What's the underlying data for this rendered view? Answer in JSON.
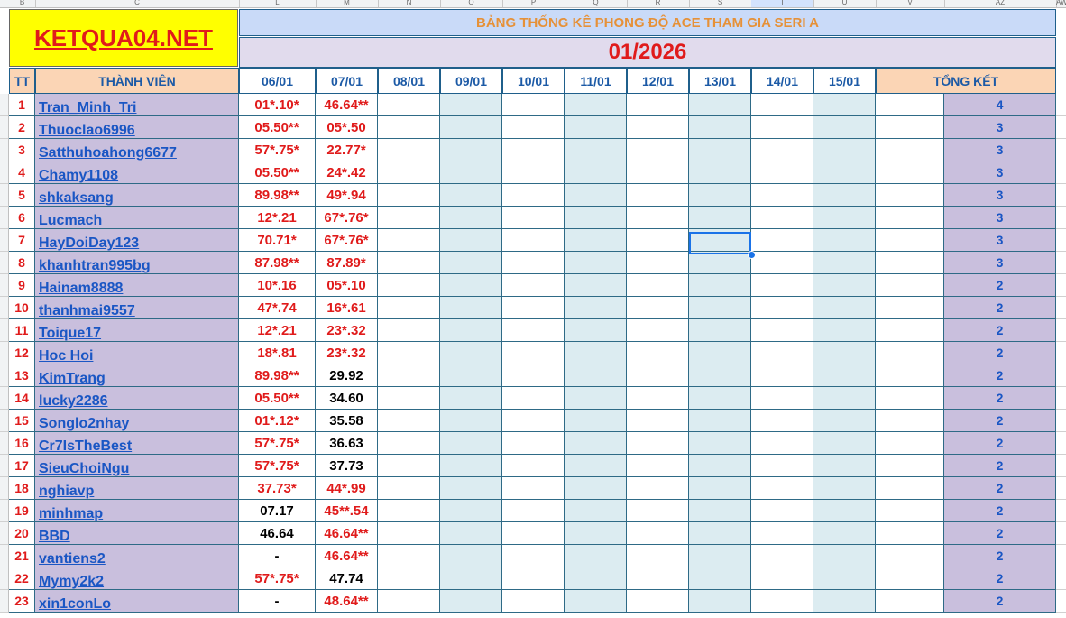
{
  "column_header_strip": {
    "letters": [
      "B",
      "C",
      "L",
      "M",
      "N",
      "O",
      "P",
      "Q",
      "R",
      "S",
      "T",
      "U",
      "V",
      "AZ",
      "AW"
    ]
  },
  "sheet": {
    "logo_text": "KETQUA04.NET",
    "title": "BẢNG THỐNG KÊ PHONG ĐỘ ACE THAM GIA SERI A",
    "month": "01/2026",
    "headers": {
      "tt": "TT",
      "member": "THÀNH VIÊN",
      "dates": [
        "06/01",
        "07/01",
        "08/01",
        "09/01",
        "10/01",
        "11/01",
        "12/01",
        "13/01",
        "14/01",
        "15/01"
      ],
      "summary": "TỔNG KẾT"
    },
    "rows": [
      {
        "tt": "1",
        "name": "Tran_Minh_Tri",
        "d1": "01*.10*",
        "d1c": "red",
        "d2": "46.64**",
        "d2c": "red",
        "total": "4"
      },
      {
        "tt": "2",
        "name": "Thuoclao6996",
        "d1": "05.50**",
        "d1c": "red",
        "d2": "05*.50",
        "d2c": "red",
        "total": "3"
      },
      {
        "tt": "3",
        "name": "Satthuhoahong6677",
        "d1": "57*.75*",
        "d1c": "red",
        "d2": "22.77*",
        "d2c": "red",
        "total": "3"
      },
      {
        "tt": "4",
        "name": "Chamy1108",
        "d1": "05.50**",
        "d1c": "red",
        "d2": "24*.42",
        "d2c": "red",
        "total": "3"
      },
      {
        "tt": "5",
        "name": "shkaksang",
        "d1": "89.98**",
        "d1c": "red",
        "d2": "49*.94",
        "d2c": "red",
        "total": "3"
      },
      {
        "tt": "6",
        "name": "Lucmach",
        "d1": "12*.21",
        "d1c": "red",
        "d2": "67*.76*",
        "d2c": "red",
        "total": "3"
      },
      {
        "tt": "7",
        "name": "HayDoiDay123",
        "d1": "70.71*",
        "d1c": "red",
        "d2": "67*.76*",
        "d2c": "red",
        "total": "3"
      },
      {
        "tt": "8",
        "name": "khanhtran995bg",
        "d1": "87.98**",
        "d1c": "red",
        "d2": "87.89*",
        "d2c": "red",
        "total": "3"
      },
      {
        "tt": "9",
        "name": "Hainam8888",
        "d1": "10*.16",
        "d1c": "red",
        "d2": "05*.10",
        "d2c": "red",
        "total": "2"
      },
      {
        "tt": "10",
        "name": "thanhmai9557",
        "d1": "47*.74",
        "d1c": "red",
        "d2": "16*.61",
        "d2c": "red",
        "total": "2"
      },
      {
        "tt": "11",
        "name": "Toique17",
        "d1": "12*.21",
        "d1c": "red",
        "d2": "23*.32",
        "d2c": "red",
        "total": "2"
      },
      {
        "tt": "12",
        "name": "Hoc Hoi",
        "d1": "18*.81",
        "d1c": "red",
        "d2": "23*.32",
        "d2c": "red",
        "total": "2"
      },
      {
        "tt": "13",
        "name": "KimTrang",
        "d1": "89.98**",
        "d1c": "red",
        "d2": "29.92",
        "d2c": "dark",
        "total": "2"
      },
      {
        "tt": "14",
        "name": "lucky2286",
        "d1": "05.50**",
        "d1c": "red",
        "d2": "34.60",
        "d2c": "dark",
        "total": "2"
      },
      {
        "tt": "15",
        "name": "Songlo2nhay",
        "d1": "01*.12*",
        "d1c": "red",
        "d2": "35.58",
        "d2c": "dark",
        "total": "2"
      },
      {
        "tt": "16",
        "name": "Cr7IsTheBest",
        "d1": "57*.75*",
        "d1c": "red",
        "d2": "36.63",
        "d2c": "dark",
        "total": "2"
      },
      {
        "tt": "17",
        "name": "SieuChoiNgu",
        "d1": "57*.75*",
        "d1c": "red",
        "d2": "37.73",
        "d2c": "dark",
        "total": "2"
      },
      {
        "tt": "18",
        "name": "nghiavp",
        "d1": "37.73*",
        "d1c": "red",
        "d2": "44*.99",
        "d2c": "red",
        "total": "2"
      },
      {
        "tt": "19",
        "name": "minhmap",
        "d1": "07.17",
        "d1c": "dark",
        "d2": "45**.54",
        "d2c": "red",
        "total": "2"
      },
      {
        "tt": "20",
        "name": "BBD",
        "d1": "46.64",
        "d1c": "dark",
        "d2": "46.64**",
        "d2c": "red",
        "total": "2"
      },
      {
        "tt": "21",
        "name": "vantiens2",
        "d1": "-",
        "d1c": "dark",
        "d2": "46.64**",
        "d2c": "red",
        "total": "2"
      },
      {
        "tt": "22",
        "name": "Mymy2k2",
        "d1": "57*.75*",
        "d1c": "red",
        "d2": "47.74",
        "d2c": "dark",
        "total": "2"
      },
      {
        "tt": "23",
        "name": "xin1conLo",
        "d1": "-",
        "d1c": "dark",
        "d2": "48.64**",
        "d2c": "red",
        "total": "2"
      }
    ]
  },
  "colors": {
    "accent_red": "#e01b1b",
    "link_blue": "#1a56c4",
    "member_bg": "#c9bfdd",
    "title_orange": "#e69138",
    "selection_blue": "#1a73e8"
  }
}
